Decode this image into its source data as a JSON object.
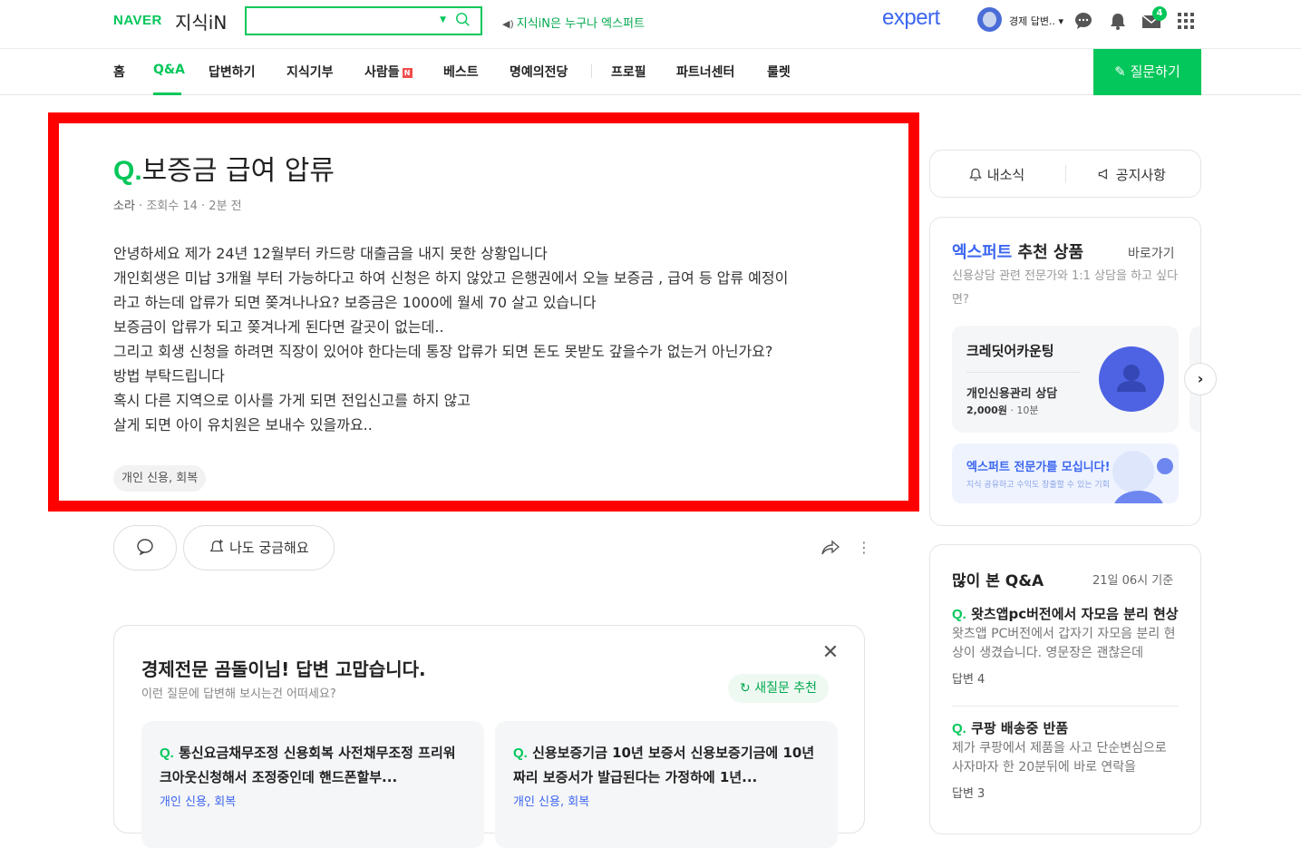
{
  "header": {
    "logo_naver": "NAVER",
    "logo_jisik": "지식iN",
    "search_placeholder": "",
    "notice": "지식iN은 누구나 엑스퍼트",
    "expert_logo": "expert",
    "user_name": "경제 답변..",
    "mail_badge": "4"
  },
  "nav": {
    "items": [
      "홈",
      "Q&A",
      "답변하기",
      "지식기부",
      "사람들",
      "베스트",
      "명예의전당",
      "프로필",
      "파트너센터",
      "룰렛"
    ],
    "new_badge": "N",
    "active": "Q&A",
    "ask_button": "질문하기"
  },
  "question": {
    "q_mark": "Q.",
    "title": "보증금 급여 압류",
    "author": "소라",
    "views": "조회수 14",
    "time": "2분 전",
    "body": [
      "안녕하세요 제가 24년 12월부터 카드랑 대출금을 내지 못한 상황입니다",
      "개인회생은 미납 3개월 부터 가능하다고 하여 신청은 하지 않았고 은행권에서 오늘 보증금 , 급여 등 압류 예정이",
      "라고 하는데 압류가 되면 쫒겨나나요? 보증금은 1000에 월세 70 살고 있습니다",
      "보증금이 압류가 되고 쫒겨나게 된다면 갈곳이 없는데..",
      "그리고 회생 신청을 하려면 직장이 있어야 한다는데 통장 압류가 되면 돈도 못받도 갚을수가 없는거 아닌가요?",
      "방법 부탁드립니다",
      "혹시 다른 지역으로 이사를 가게 되면 전입신고를 하지 않고",
      "살게 되면 아이 유치원은 보내수 있을까요.."
    ],
    "tag": "개인 신용, 회복",
    "curious_button": "나도 궁금해요"
  },
  "thanks": {
    "title": "경제전문 곰돌이님! 답변 고맙습니다.",
    "subtitle": "이런 질문에 답변해 보시는건 어떠세요?",
    "new_question_button": "새질문 추천",
    "cards": [
      {
        "q_mark": "Q.",
        "title": "통신요금채무조정 신용회복 사전채무조정 프리워크아웃신청해서 조정중인데 핸드폰할부...",
        "tag": "개인 신용, 회복"
      },
      {
        "q_mark": "Q.",
        "title": "신용보증기금 10년 보증서 신용보증기금에 10년짜리 보증서가 발급된다는 가정하에 1년...",
        "tag": "개인 신용, 회복"
      }
    ]
  },
  "sidebar": {
    "tabs": [
      "내소식",
      "공지사항"
    ],
    "expert": {
      "title_blue": "엑스퍼트",
      "title_rest": " 추천 상품",
      "go_link": "바로가기",
      "desc": "신용상담 관련 전문가와 1:1 상담을 하고 싶다면?",
      "product": {
        "name": "크레딧어카운팅",
        "service": "개인신용관리 상담",
        "price": "2,000원",
        "duration": "10분"
      },
      "recruit_title": "엑스퍼트 전문가를 모십니다!",
      "recruit_sub": "지식 공유하고 수익도 창출할 수 있는 기회"
    },
    "popular": {
      "title": "많이 본 Q&A",
      "time": "21일 06시 기준",
      "items": [
        {
          "q_mark": "Q.",
          "title": "왓츠앱pc버전에서 자모음 분리 현상",
          "desc": "왓츠앱 PC버전에서 갑자기 자모음 분리 현상이 생겼습니다. 영문장은 괜찮은데",
          "answers": "답변 4"
        },
        {
          "q_mark": "Q.",
          "title": "쿠팡 배송중 반품",
          "desc": "제가 쿠팡에서 제품을 사고 단순변심으로 사자마자 한 20분뒤에 바로 연락을",
          "answers": "답변 3"
        }
      ]
    }
  },
  "colors": {
    "brand_green": "#03c75a",
    "expert_blue": "#3c66f0",
    "highlight_red": "#ff0000"
  }
}
